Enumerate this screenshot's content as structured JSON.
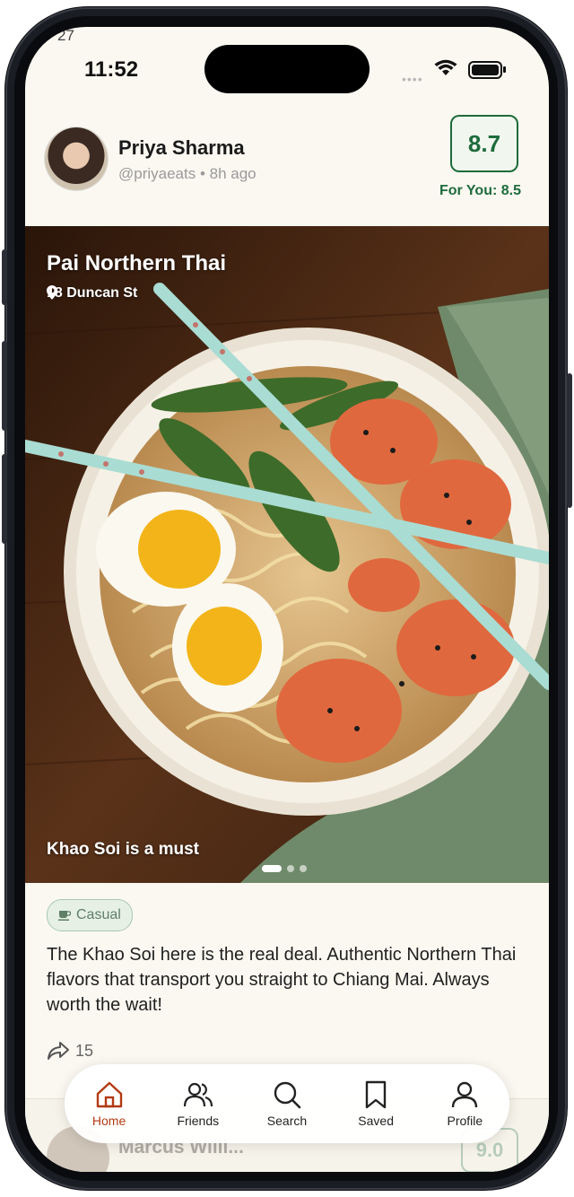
{
  "status_bar": {
    "prev_label": "27",
    "time": "11:52",
    "signal": "••••"
  },
  "post": {
    "author_name": "Priya Sharma",
    "author_meta": "@priyaeats • 8h ago",
    "score": "8.7",
    "for_you": "For You: 8.5",
    "restaurant": "Pai Northern Thai",
    "address": "18 Duncan St",
    "photo_caption": "Khao Soi is a must",
    "tag": "Casual",
    "review": "The Khao Soi here is the real deal. Authentic Northern Thai flavors that transport you straight to Chiang Mai. Always worth the wait!",
    "share_count": "15"
  },
  "next_post": {
    "author_name": "Marcus Willi...",
    "score": "9.0"
  },
  "nav": {
    "items": [
      {
        "label": "Home",
        "icon": "home-icon"
      },
      {
        "label": "Friends",
        "icon": "friends-icon"
      },
      {
        "label": "Search",
        "icon": "search-icon"
      },
      {
        "label": "Saved",
        "icon": "bookmark-icon"
      },
      {
        "label": "Profile",
        "icon": "profile-icon"
      }
    ]
  },
  "colors": {
    "accent": "#1e6b3c",
    "active_nav": "#b23a12",
    "background": "#fbf8f1"
  }
}
